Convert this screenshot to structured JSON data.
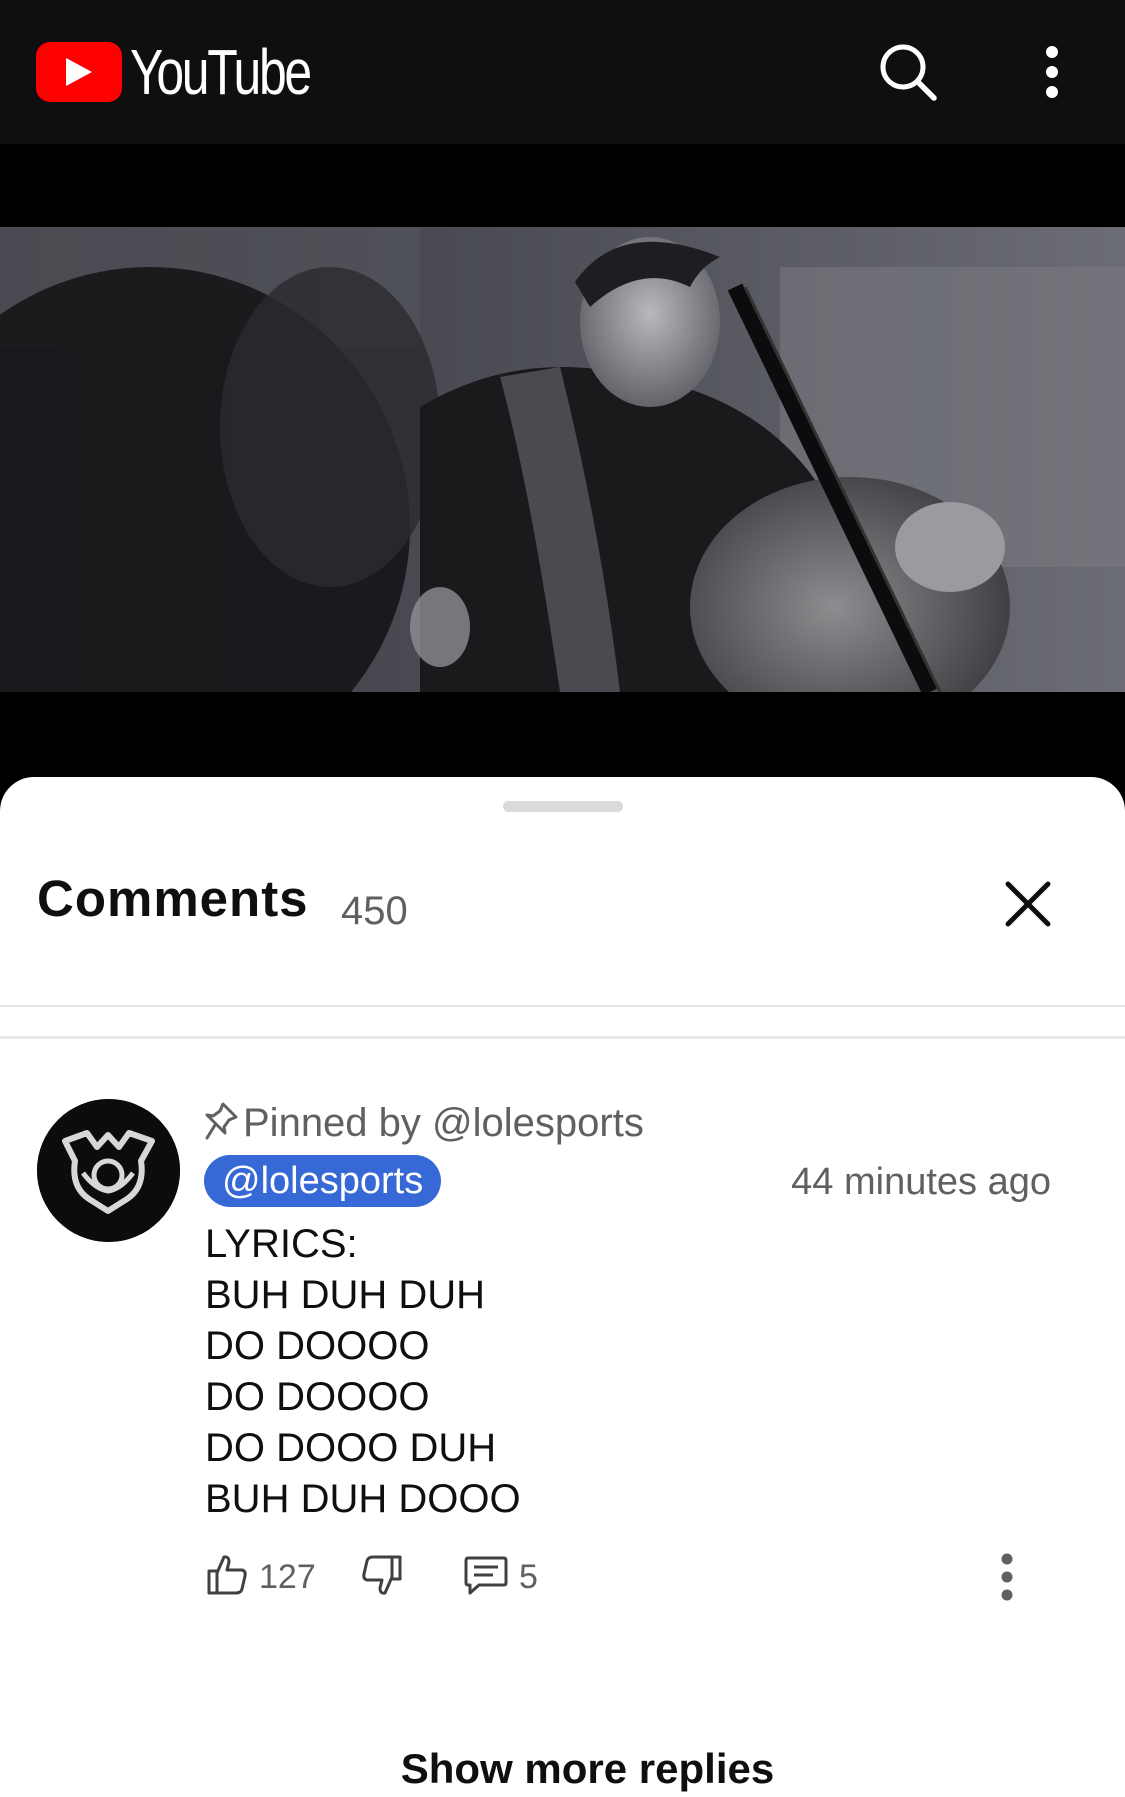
{
  "app": {
    "brand": "YouTube",
    "icons": {
      "search": "search-icon",
      "more": "more-vert-icon"
    }
  },
  "video": {
    "description": "black and white scene of a cellist playing"
  },
  "comments_sheet": {
    "title": "Comments",
    "count": "450",
    "close_icon": "close-icon"
  },
  "pinned_comment": {
    "pinned_label": "Pinned by @lolesports",
    "author": "@lolesports",
    "timestamp": "44 minutes ago",
    "lines": [
      "LYRICS:",
      "BUH DUH DUH",
      "DO DOOOO",
      "DO DOOOO",
      "DO DOOO DUH",
      "BUH DUH DOOO"
    ],
    "likes": "127",
    "replies": "5"
  },
  "show_more_replies": "Show more replies",
  "colors": {
    "brand_red": "#ff0000",
    "author_chip": "#3668d6",
    "topbar": "#0f0f0f"
  }
}
